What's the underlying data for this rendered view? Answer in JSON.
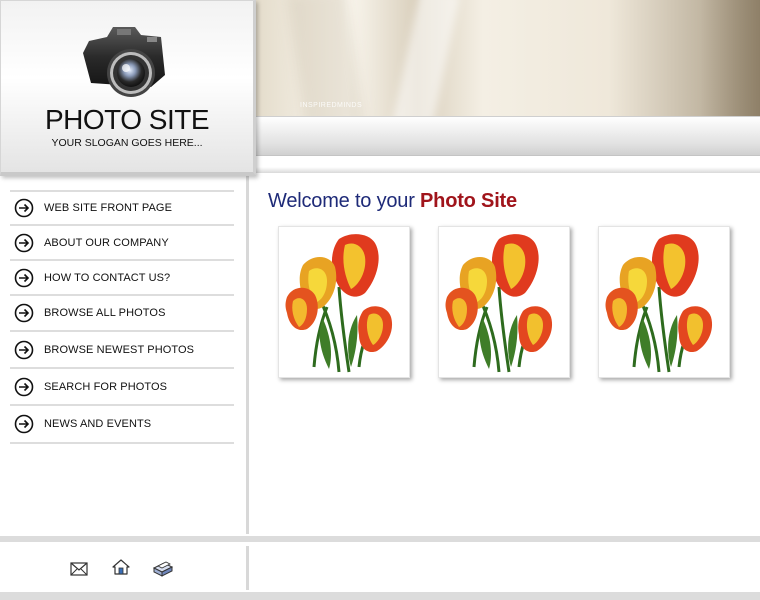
{
  "header": {
    "site_title": "PHOTO SITE",
    "slogan": "YOUR SLOGAN GOES HERE...",
    "banner_caption": "INSPIREDMINDS"
  },
  "nav": {
    "items": [
      {
        "label": "WEB SITE FRONT PAGE"
      },
      {
        "label": "ABOUT OUR COMPANY"
      },
      {
        "label": "HOW TO CONTACT US?"
      },
      {
        "label": "BROWSE ALL PHOTOS"
      },
      {
        "label": "BROWSE NEWEST PHOTOS"
      },
      {
        "label": "SEARCH FOR PHOTOS"
      },
      {
        "label": "NEWS AND EVENTS"
      }
    ]
  },
  "content": {
    "welcome_prefix": "Welcome to your ",
    "welcome_accent": "Photo Site",
    "photos": [
      {
        "subject": "tulips"
      },
      {
        "subject": "tulips"
      },
      {
        "subject": "tulips"
      }
    ]
  },
  "footer": {
    "icons": [
      "mail-icon",
      "home-icon",
      "print-icon"
    ]
  },
  "colors": {
    "welcome_blue": "#1e2a78",
    "welcome_accent_red": "#a0141b"
  }
}
